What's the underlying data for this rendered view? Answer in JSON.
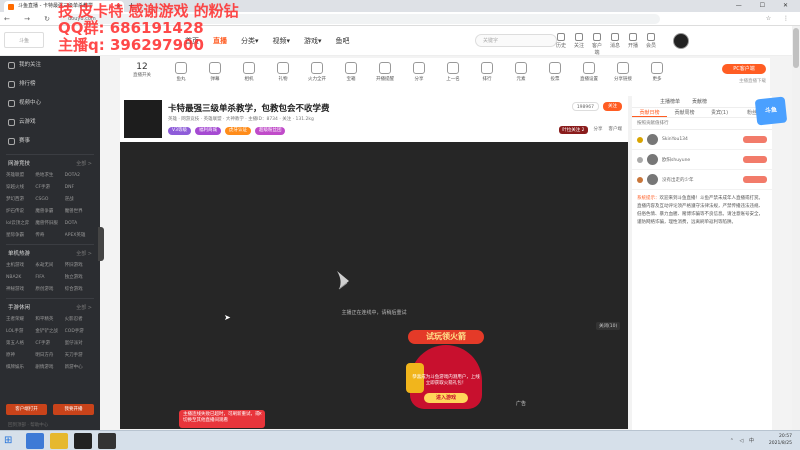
{
  "watermark": {
    "line1": "技 皮卡特 感谢游戏 的粉钻",
    "line2": "QQ群: 686191428",
    "line3": "主播q: 396297900"
  },
  "browser": {
    "tab_title": "斗鱼直播 - 卡特最强三级单杀教学",
    "url": "douyu.com",
    "new_tab": "+",
    "window_controls": "— ☐ ✕",
    "nav": "← → ↻ ⌂",
    "ext_icons": "☆ ⋮"
  },
  "header": {
    "logo": "斗鱼",
    "nav": [
      "首页",
      "直播",
      "分类▾",
      "视频▾",
      "游戏▾",
      "鱼吧"
    ],
    "search_placeholder": "关键字",
    "icons": [
      "历史",
      "关注",
      "客户端",
      "消息",
      "开播",
      "会员"
    ]
  },
  "sidebar": {
    "items": [
      "我的关注",
      "排行榜",
      "视频中心",
      "云游戏",
      "赛事"
    ],
    "sections": [
      {
        "title": "网游竞技",
        "more": "全部 >",
        "games": [
          "英雄联盟",
          "绝地求生",
          "DOTA2",
          "穿越火线",
          "CF手游",
          "DNF",
          "梦幻西游",
          "CSGO",
          "逆战",
          "炉石传说",
          "魔兽争霸",
          "魔兽世界",
          "lol云顶之弈",
          "魔兽怀旧服",
          "DOTA",
          "星际争霸",
          "传奇",
          "APEX英雄"
        ]
      },
      {
        "title": "单机热游",
        "more": "全部 >",
        "games": [
          "主机游戏",
          "永劫无间",
          "怀旧游戏",
          "NBA2K",
          "FIFA",
          "独立游戏",
          "神秘游戏",
          "原创游戏",
          "综合游戏"
        ]
      },
      {
        "title": "手游休闲",
        "more": "全部 >",
        "games": [
          "王者荣耀",
          "和平精英",
          "火影忍者",
          "LOL手游",
          "金铲铲之战",
          "COD手游",
          "第五人格",
          "CF手游",
          "蛋仔派对",
          "原神",
          "明日方舟",
          "天刀手游",
          "棋牌娱乐",
          "剧情游戏",
          "新游中心"
        ]
      }
    ],
    "buttons": [
      "客户端打开",
      "我要开播"
    ],
    "footer": "回到顶部 · 帮助中心"
  },
  "gifts": {
    "first_count": "12",
    "first_label": "直播开关",
    "items": [
      "鱼丸",
      "弹幕",
      "相机",
      "礼物",
      "火力全开",
      "宝箱",
      "开播提醒",
      "分享",
      "上一名",
      "排行",
      "元素",
      "投票",
      "直播设置",
      "分享链接",
      "更多"
    ],
    "pc_button": "PC客户端",
    "pc_sub": "主播直播下载"
  },
  "room": {
    "title": "卡特最强三级单杀教学，包教包会不收学费",
    "meta": "英雄 · 网游竞技 · 英雄联盟 · 大神教学 · 主播ID：8734  · 关注 · 131.2kg",
    "tags": [
      "V3等级",
      "福利商城",
      "虎牙认证",
      "超级粉丝团"
    ],
    "followers": "198967",
    "follow_btn": "关注",
    "badge": "叶拉关注 2",
    "actions": [
      "分享",
      "客户端"
    ]
  },
  "player": {
    "offline_text": "主播正在连线中，请稍后重试",
    "ad_label": "广告",
    "promo": {
      "ribbon": "试玩领火箭",
      "text": "恭喜成为斗鱼游戏内测用户，上线立即获取火箭礼包！",
      "button": "进入游戏",
      "close": "关闭(10)"
    },
    "toast": "主播连线失败已超时，可刷新重试，或切换至其他直播间观看"
  },
  "right_panel": {
    "top": [
      "主播榜单",
      "贡献榜"
    ],
    "tabs": [
      "贡献日榜",
      "贡献周榜",
      "贵宾(1)",
      "粉丝团"
    ],
    "desc": "按照贡献值排行",
    "fans": [
      "SkinYou134",
      "欧阳shuyune",
      "没有出走的少年"
    ],
    "notice_label": "系统提示：",
    "notice": "欢迎来到斗鱼直播！斗鱼严禁未成年人直播或打赏。直播内容及互动评论须严格遵守法律法规，严禁传播违法违规、低俗色情、暴力血腥、赌博诈骗等不良信息。请注意账号安全，谨防网络诈骗，理性消费，远离刷单返利等陷阱。",
    "logo": "斗鱼"
  },
  "taskbar": {
    "time": "20:57",
    "date": "2021/8/25",
    "tray": "⌃ ◁ 中"
  },
  "colors": {
    "accent": "#ff5d23",
    "sidebar_bg": "#2b2d31",
    "player_bg": "#262626"
  }
}
